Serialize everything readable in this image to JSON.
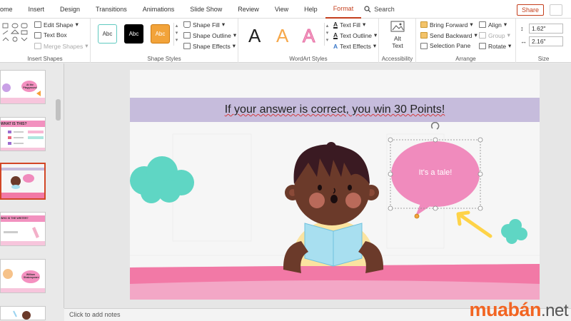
{
  "tabs": [
    "ome",
    "Insert",
    "Design",
    "Transitions",
    "Animations",
    "Slide Show",
    "Review",
    "View",
    "Help",
    "Format"
  ],
  "search_label": "Search",
  "share_label": "Share",
  "ribbon": {
    "insert_shapes": {
      "label": "Insert Shapes",
      "edit_shape": "Edit Shape",
      "text_box": "Text Box",
      "merge_shapes": "Merge Shapes"
    },
    "shape_styles": {
      "label": "Shape Styles",
      "presets": [
        "Abc",
        "Abc",
        "Abc"
      ],
      "fill": "Shape Fill",
      "outline": "Shape Outline",
      "effects": "Shape Effects"
    },
    "wordart_styles": {
      "label": "WordArt Styles",
      "letters": [
        "A",
        "A",
        "A"
      ],
      "text_fill": "Text Fill",
      "text_outline": "Text Outline",
      "text_effects": "Text Effects"
    },
    "accessibility": {
      "label": "Accessibility",
      "alt_text_line1": "Alt",
      "alt_text_line2": "Text"
    },
    "arrange": {
      "label": "Arrange",
      "bring_forward": "Bring Forward",
      "send_backward": "Send Backward",
      "selection_pane": "Selection Pane",
      "align": "Align",
      "group": "Group",
      "rotate": "Rotate"
    },
    "size": {
      "label": "Size",
      "height": "1.62\"",
      "width": "2.16\""
    }
  },
  "slide": {
    "title": "If your answer is correct, you win 30 Points!",
    "bubble_text": "It's a tale!"
  },
  "thumbs_text": {
    "t1": "At the Playground",
    "t2": "WHAT IS THIS?",
    "t4": "WHO IS THE WRITER?",
    "t5": "William Shakespeare"
  },
  "notes_placeholder": "Click to add notes",
  "watermark": {
    "part1": "muab",
    "part2": "án",
    "part3": ".net"
  },
  "colors": {
    "accent": "#c43e1c",
    "title_bar": "#c6bcdc",
    "bubble": "#f08bbd",
    "cloud": "#5fd6c4",
    "floor": "#f279a6"
  }
}
